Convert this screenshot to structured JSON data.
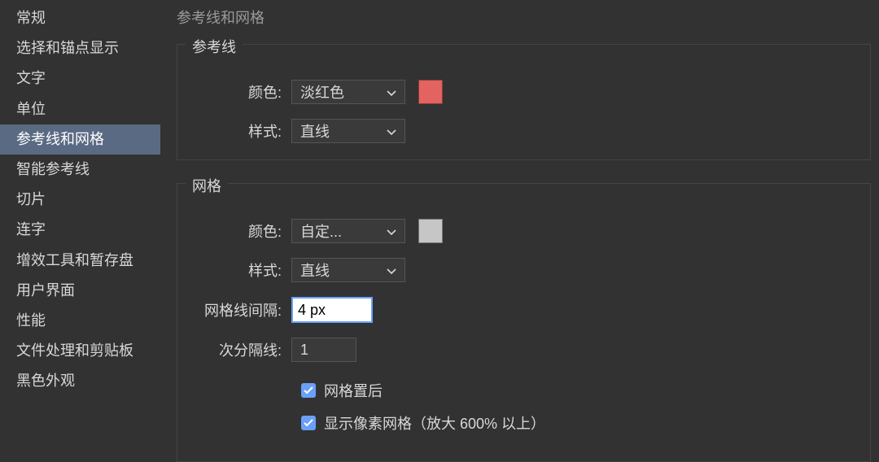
{
  "sidebar": {
    "items": [
      {
        "label": "常规"
      },
      {
        "label": "选择和锚点显示"
      },
      {
        "label": "文字"
      },
      {
        "label": "单位"
      },
      {
        "label": "参考线和网格"
      },
      {
        "label": "智能参考线"
      },
      {
        "label": "切片"
      },
      {
        "label": "连字"
      },
      {
        "label": "增效工具和暂存盘"
      },
      {
        "label": "用户界面"
      },
      {
        "label": "性能"
      },
      {
        "label": "文件处理和剪贴板"
      },
      {
        "label": "黑色外观"
      }
    ],
    "activeIndex": 4
  },
  "page": {
    "title": "参考线和网格"
  },
  "guides": {
    "legend": "参考线",
    "colorLabel": "颜色:",
    "colorValue": "淡红色",
    "colorSwatch": "#e26360",
    "styleLabel": "样式:",
    "styleValue": "直线"
  },
  "grid": {
    "legend": "网格",
    "colorLabel": "颜色:",
    "colorValue": "自定...",
    "colorSwatch": "#c6c6c6",
    "styleLabel": "样式:",
    "styleValue": "直线",
    "spacingLabel": "网格线间隔:",
    "spacingValue": "4 px",
    "subdividerLabel": "次分隔线:",
    "subdividerValue": "1",
    "gridBack": {
      "checked": true,
      "label": "网格置后"
    },
    "pixelGrid": {
      "checked": true,
      "label": "显示像素网格（放大 600% 以上）"
    }
  }
}
